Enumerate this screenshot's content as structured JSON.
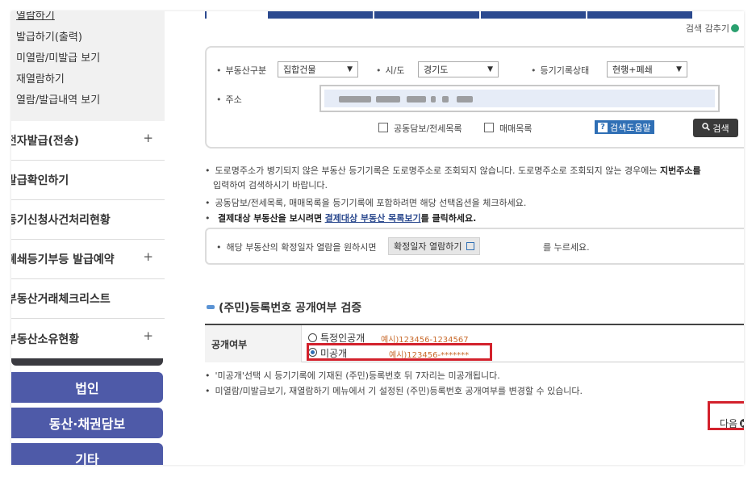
{
  "sidebar": {
    "sub_items": [
      "열람하기",
      "발급하기(출력)",
      "미열람/미발급 보기",
      "재열람하기",
      "열람/발급내역 보기"
    ],
    "items": [
      {
        "label": "전자발급(전송)",
        "plus": "+"
      },
      {
        "label": "발급확인하기",
        "plus": ""
      },
      {
        "label": "등기신청사건처리현황",
        "plus": ""
      },
      {
        "label": "폐쇄등기부등 발급예약",
        "plus": "+"
      },
      {
        "label": "부동산거래체크리스트",
        "plus": ""
      },
      {
        "label": "부동산소유현황",
        "plus": "+"
      }
    ],
    "buttons": [
      "법인",
      "동산·채권담보",
      "기타"
    ]
  },
  "search": {
    "toggle_label": "검색 감추기",
    "type_label": "부동산구분",
    "type_value": "집합건물",
    "region_label": "시/도",
    "region_value": "경기도",
    "status_label": "등기기록상태",
    "status_value": "현행+폐쇄",
    "address_label": "주소",
    "joint_label": "공동담보/전세목록",
    "trade_label": "매매목록",
    "help_label": "검색도움말",
    "search_label": "검색"
  },
  "notes": {
    "line1": "도로명주소가 병기되지 않은 부동산 등기기록은 도로명주소로 조회되지 않습니다. 도로명주소로 조회되지 않는 경우에는",
    "line1_bold": "지번주소를",
    "line1_cont": "입력하여 검색하시기 바랍니다.",
    "line2": "공동담보/전세목록, 매매목록을 등기기록에 포함하려면 해당 선택옵션을 체크하세요.",
    "line3_bold_a": "결제대상 부동산을 보시려면",
    "line3_link": "결제대상 부동산 목록보기",
    "line3_bold_b": "를 클릭하세요."
  },
  "confirm": {
    "text": "해당 부동산의 확정일자 열람을 원하시면",
    "button": "확정일자 열람하기",
    "after": "를 누르세요."
  },
  "disclosure": {
    "title": "(주민)등록번호 공개여부 검증",
    "header": "공개여부",
    "option1": "특정인공개",
    "option1_example": "예시)123456-1234567",
    "option2": "미공개",
    "option2_example": "예시)123456-*******",
    "note1": "'미공개'선택 시 등기기록에 기재된 (주민)등록번호 뒤 7자리는 미공개됩니다.",
    "note2": "미열람/미발급보기, 재열람하기 메뉴에서 기 설정된 (주민)등록번호 공개여부를 변경할 수 있습니다."
  },
  "next_label": "다음",
  "colors": {
    "accent": "#2c4a8f",
    "sidebar_button": "#4e5aa8",
    "highlight": "#d3212c"
  }
}
